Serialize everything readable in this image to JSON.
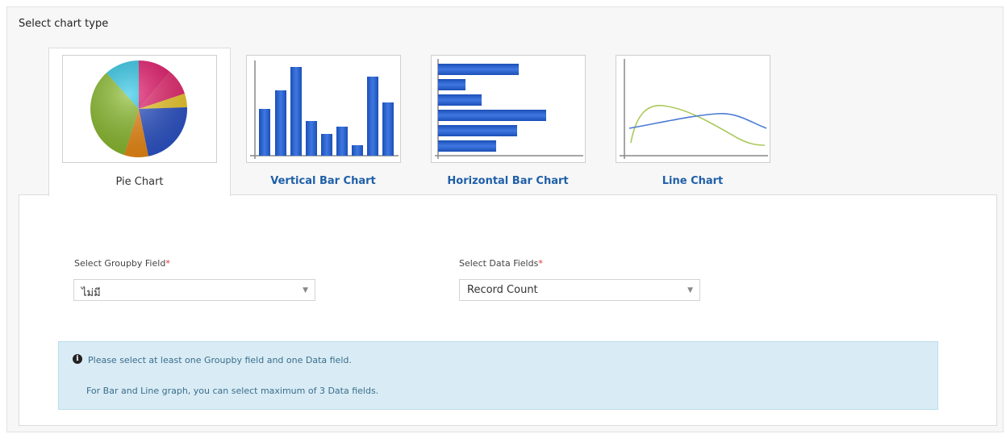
{
  "section_title": "Select chart type",
  "tabs": [
    {
      "label": "Pie Chart",
      "active": true,
      "icon": "pie-chart-icon"
    },
    {
      "label": "Vertical Bar Chart",
      "active": false,
      "icon": "vertical-bar-chart-icon"
    },
    {
      "label": "Horizontal Bar Chart",
      "active": false,
      "icon": "horizontal-bar-chart-icon"
    },
    {
      "label": "Line Chart",
      "active": false,
      "icon": "line-chart-icon"
    }
  ],
  "groupby": {
    "label": "Select Groupby Field",
    "required_mark": "*",
    "value": "ไม่มี"
  },
  "datafields": {
    "label": "Select Data Fields",
    "required_mark": "*",
    "value": "Record Count"
  },
  "alert": {
    "icon": "info-icon",
    "line1": "Please select at least one Groupby field and one Data field.",
    "line2": "For Bar and Line graph, you can select maximum of 3 Data fields."
  },
  "colors": {
    "link": "#1f5fa8",
    "required": "#d9312b",
    "alert_bg": "#d9ecf5",
    "alert_text": "#3a6d8c",
    "bar_blue": "#2f63c9"
  }
}
